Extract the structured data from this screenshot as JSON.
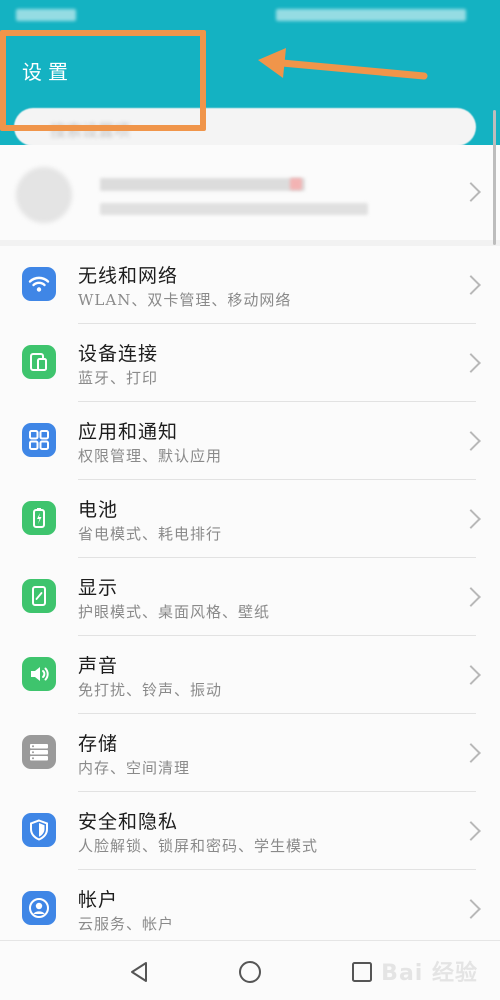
{
  "header": {
    "title": "设置"
  },
  "search": {
    "placeholder": "搜索设置项"
  },
  "settings": [
    {
      "label": "无线和网络",
      "sub": "WLAN、双卡管理、移动网络",
      "icon": "wifi-icon",
      "color": "#3f86e6"
    },
    {
      "label": "设备连接",
      "sub": "蓝牙、打印",
      "icon": "device-connect-icon",
      "color": "#3ec46d"
    },
    {
      "label": "应用和通知",
      "sub": "权限管理、默认应用",
      "icon": "apps-icon",
      "color": "#3f86e6"
    },
    {
      "label": "电池",
      "sub": "省电模式、耗电排行",
      "icon": "battery-icon",
      "color": "#3ec46d"
    },
    {
      "label": "显示",
      "sub": "护眼模式、桌面风格、壁纸",
      "icon": "display-icon",
      "color": "#3ec46d"
    },
    {
      "label": "声音",
      "sub": "免打扰、铃声、振动",
      "icon": "sound-icon",
      "color": "#3ec46d"
    },
    {
      "label": "存储",
      "sub": "内存、空间清理",
      "icon": "storage-icon",
      "color": "#9a9a9a"
    },
    {
      "label": "安全和隐私",
      "sub": "人脸解锁、锁屏和密码、学生模式",
      "icon": "shield-icon",
      "color": "#3f86e6"
    },
    {
      "label": "帐户",
      "sub": "云服务、帐户",
      "icon": "account-icon",
      "color": "#3f86e6"
    }
  ],
  "colors": {
    "accent": "#14b2c2",
    "highlight": "#f0954a"
  },
  "watermark": "Bai 经验"
}
